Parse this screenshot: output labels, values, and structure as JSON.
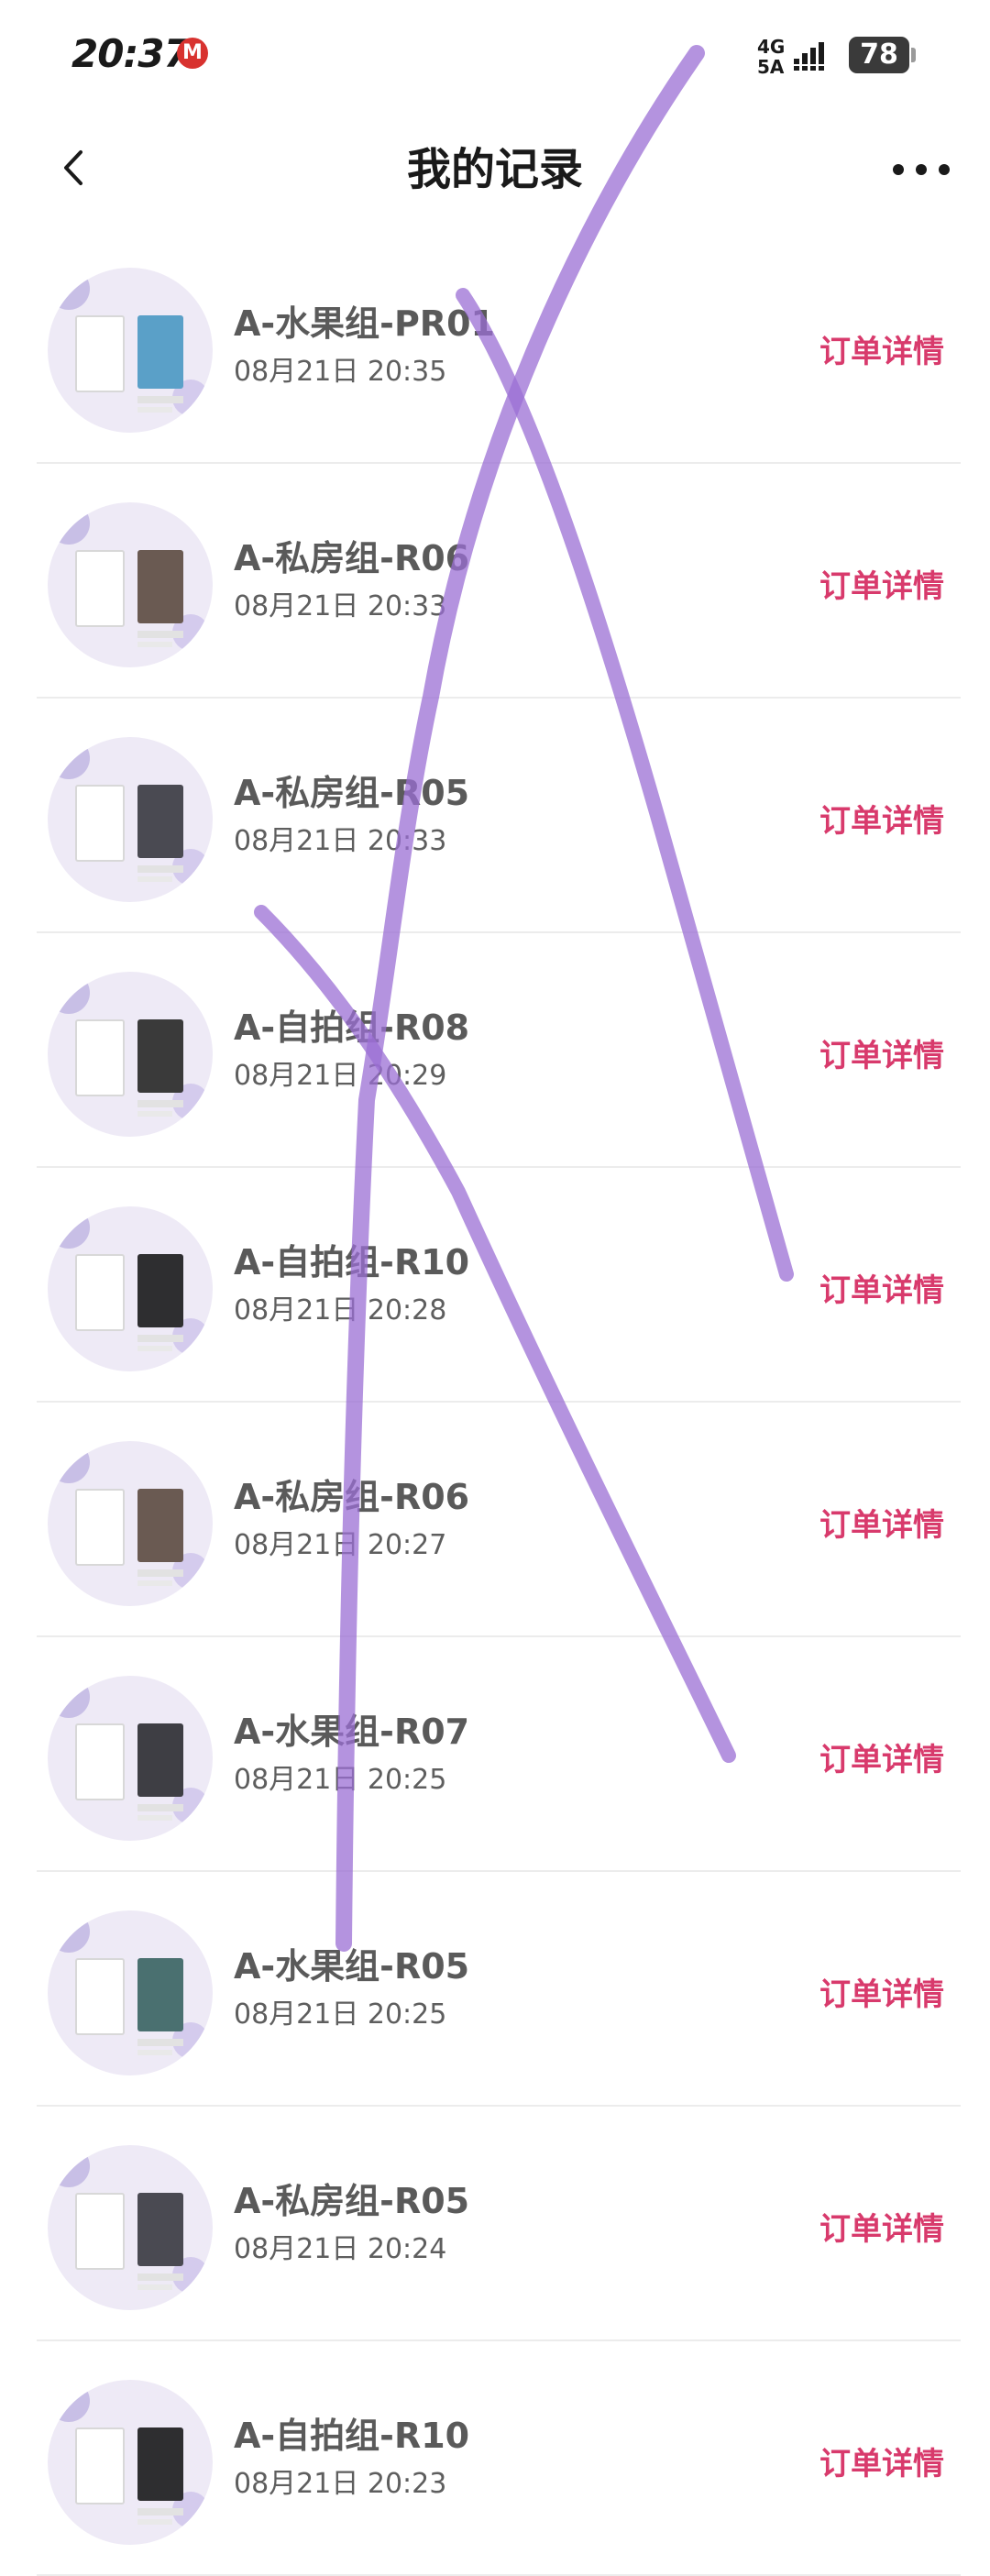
{
  "status_bar": {
    "time": "20:37",
    "carrier_icon": "M",
    "network_label": "4G\n5A",
    "battery_level": "78"
  },
  "header": {
    "title": "我的记录",
    "back_icon": "chevron-left-icon",
    "more_icon": "more-dots-icon"
  },
  "records": [
    {
      "name": "A-水果组-PR01",
      "time": "08月21日 20:35",
      "action": "订单详情",
      "thumb_color": "#5aa0c8"
    },
    {
      "name": "A-私房组-R06",
      "time": "08月21日 20:33",
      "action": "订单详情",
      "thumb_color": "#6a5a52"
    },
    {
      "name": "A-私房组-R05",
      "time": "08月21日 20:33",
      "action": "订单详情",
      "thumb_color": "#4a4a52"
    },
    {
      "name": "A-自拍组-R08",
      "time": "08月21日 20:29",
      "action": "订单详情",
      "thumb_color": "#3a3a3a"
    },
    {
      "name": "A-自拍组-R10",
      "time": "08月21日 20:28",
      "action": "订单详情",
      "thumb_color": "#2e2e30"
    },
    {
      "name": "A-私房组-R06",
      "time": "08月21日 20:27",
      "action": "订单详情",
      "thumb_color": "#6a5a52"
    },
    {
      "name": "A-水果组-R07",
      "time": "08月21日 20:25",
      "action": "订单详情",
      "thumb_color": "#3e3e44"
    },
    {
      "name": "A-水果组-R05",
      "time": "08月21日 20:25",
      "action": "订单详情",
      "thumb_color": "#4a7070"
    },
    {
      "name": "A-私房组-R05",
      "time": "08月21日 20:24",
      "action": "订单详情",
      "thumb_color": "#4a4a52"
    },
    {
      "name": "A-自拍组-R10",
      "time": "08月21日 20:23",
      "action": "订单详情",
      "thumb_color": "#2e2e30"
    }
  ],
  "colors": {
    "accent": "#d83a6c",
    "scribble": "#9b6fd4"
  }
}
